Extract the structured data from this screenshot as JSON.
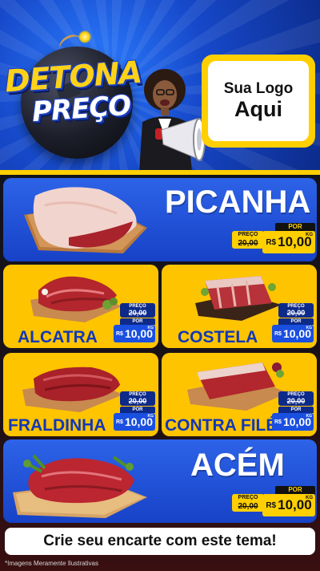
{
  "header": {
    "title_line1": "DETONA",
    "title_line2": "PREÇO",
    "logo_line1": "Sua Logo",
    "logo_line2": "Aqui"
  },
  "products": [
    {
      "name": "PICANHA",
      "old_label": "PREÇO",
      "old_price": "20,00",
      "now_label": "POR",
      "currency": "R$",
      "price": "10,00",
      "unit": "KG"
    },
    {
      "name": "ALCATRA",
      "old_label": "PREÇO",
      "old_price": "20,00",
      "now_label": "POR",
      "currency": "R$",
      "price": "10,00",
      "unit": "KG"
    },
    {
      "name": "COSTELA",
      "old_label": "PREÇO",
      "old_price": "20,00",
      "now_label": "POR",
      "currency": "R$",
      "price": "10,00",
      "unit": "KG"
    },
    {
      "name": "FRALDINHA",
      "old_label": "PREÇO",
      "old_price": "20,00",
      "now_label": "POR",
      "currency": "R$",
      "price": "10,00",
      "unit": "KG"
    },
    {
      "name": "CONTRA FILÉ",
      "old_label": "PREÇO",
      "old_price": "20,00",
      "now_label": "POR",
      "currency": "R$",
      "price": "10,00",
      "unit": "KG"
    },
    {
      "name": "ACÉM",
      "old_label": "PREÇO",
      "old_price": "20,00",
      "now_label": "POR",
      "currency": "R$",
      "price": "10,00",
      "unit": "KG"
    }
  ],
  "cta": "Crie seu encarte com este tema!",
  "disclaimer": "*Imagens Meramente Ilustrativas",
  "colors": {
    "brand_blue": "#1742c7",
    "brand_yellow": "#ffc400",
    "meat_red": "#b8222a"
  },
  "icons": {
    "bomb": "bomb-icon",
    "megaphone": "megaphone-icon"
  }
}
